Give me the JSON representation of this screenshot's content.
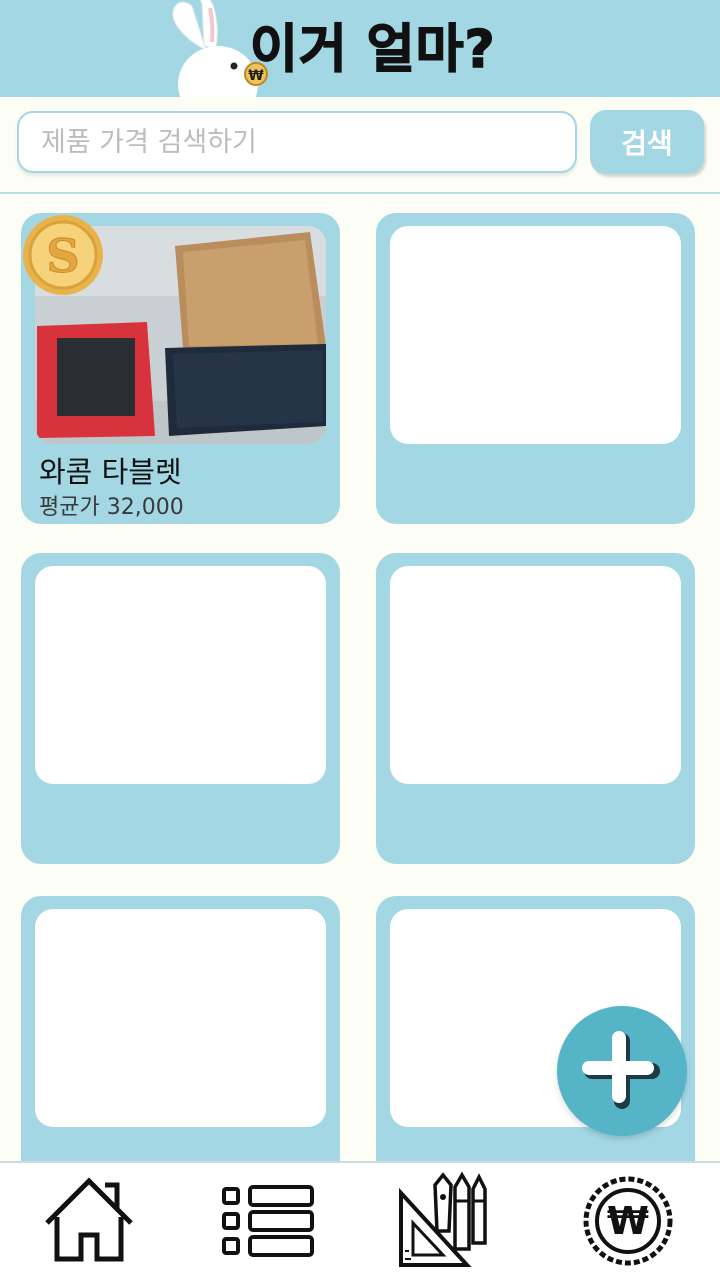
{
  "app": {
    "title": "이거 얼마?"
  },
  "search": {
    "placeholder": "제품 가격 검색하기",
    "button_label": "검색"
  },
  "products": [
    {
      "name": "와콤 타블렛",
      "price": "평균가 32,000"
    },
    {
      "name": "",
      "price": ""
    },
    {
      "name": "",
      "price": ""
    },
    {
      "name": "",
      "price": ""
    },
    {
      "name": "",
      "price": ""
    },
    {
      "name": "",
      "price": ""
    }
  ],
  "icons": {
    "mascot": "rabbit-mascot-icon",
    "coin": "coin-icon",
    "add": "plus-icon",
    "nav": [
      "home-icon",
      "list-icon",
      "drawing-tools-icon",
      "won-coin-icon"
    ]
  },
  "colors": {
    "primary": "#a3d7e4",
    "fab": "#55b4c6",
    "background": "#fcfdf4"
  }
}
